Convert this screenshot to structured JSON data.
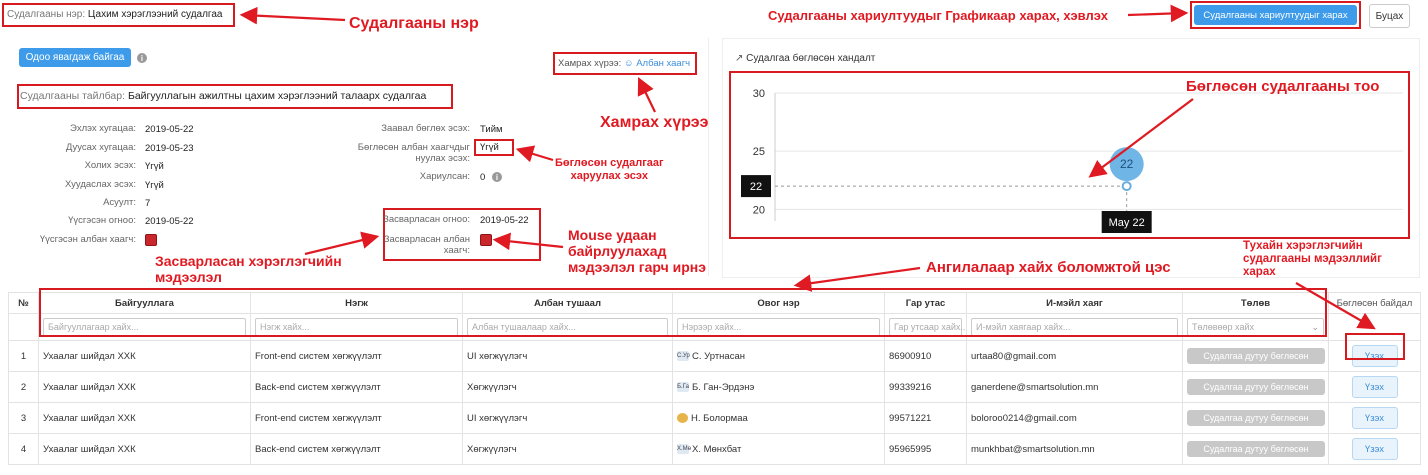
{
  "header": {
    "survey_name_label": "Судалгааны нэр:",
    "survey_name_value": "Цахим хэрэглээний судалгаа",
    "view_results_button": "Судалгааны хариултуудыг харах",
    "back_button": "Буцах"
  },
  "annotations": {
    "survey_name": "Судалгааны нэр",
    "graph_print": "Судалгааны хариултуудыг Графикаар харах, хэвлэх",
    "coverage": "Хамрах хүрээ",
    "submitted_count": "Бөглөсөн судалгааны тоо",
    "show_to_filled_line1": "Бөглөсөн судалгааг",
    "show_to_filled_line2": "харуулах эсэх",
    "mouse_line1": "Mouse удаан",
    "mouse_line2": "байрлуулахад",
    "mouse_line3": "мэдээлэл гарч ирнэ",
    "edited_user_line1": "Засварласан хэрэглэгчийн",
    "edited_user_line2": "мэдээлэл",
    "filter_row": "Ангилалаар хайх боломжтой цэс",
    "user_info_line1": "Тухайн хэрэглэгчийн",
    "user_info_line2": "судалгааны мэдээллийг",
    "user_info_line3": "харах"
  },
  "info_panel": {
    "status_badge": "Одоо явагдаж байгаа",
    "coverage_label": "Хамрах хүрээ:",
    "coverage_value": "Албан хаагч",
    "description_label": "Судалгааны тайлбар:",
    "description_value": "Байгууллагын ажилтны цахим хэрэглээний талаарх судалгаа",
    "left_fields": [
      {
        "label": "Эхлэх хугацаа:",
        "value": "2019-05-22"
      },
      {
        "label": "Дуусах хугацаа:",
        "value": "2019-05-23"
      },
      {
        "label": "Холих эсэх:",
        "value": "Үгүй"
      },
      {
        "label": "Хуудаслах эсэх:",
        "value": "Үгүй"
      },
      {
        "label": "Асуулт:",
        "value": "7"
      },
      {
        "label": "Үүсгэсэн огноо:",
        "value": "2019-05-22"
      },
      {
        "label": "Үүсгэсэн албан хаагч:",
        "value": ""
      }
    ],
    "required_label": "Заавал бөглөх эсэх:",
    "required_value": "Тийм",
    "show_filled_label_1": "Бөглөсөн албан хаагчдыг",
    "show_filled_label_2": "нуулах эсэх:",
    "show_filled_value": "Үгүй",
    "answered_label": "Хариулсан:",
    "answered_value": "0",
    "edited_date_label": "Засварласан огноо:",
    "edited_date_value": "2019-05-22",
    "edited_by_label_1": "Засварласан албан",
    "edited_by_label_2": "хаагч:"
  },
  "chart_panel": {
    "title": "Судалгаа бөглөсөн хандалт",
    "tooltip_y": "22",
    "tooltip_x": "May 22"
  },
  "chart_data": {
    "type": "line",
    "title": "Судалгаа бөглөсөн хандалт",
    "x": [
      "May 22"
    ],
    "series": [
      {
        "values": [
          22
        ]
      }
    ],
    "ylim": [
      19,
      30
    ],
    "yticks": [
      30,
      25,
      20
    ],
    "grid": true,
    "data_labels": [
      "22"
    ]
  },
  "table": {
    "headers": [
      "№",
      "Байгууллага",
      "Нэгж",
      "Албан тушаал",
      "Овог нэр",
      "Гар утас",
      "И-мэйл хаяг",
      "Төлөв",
      "Бөглөсөн байдал"
    ],
    "filter_placeholders": [
      "Байгууллагаар хайх...",
      "Нэгж хайх...",
      "Албан тушаалаар хайх...",
      "Нэрээр хайх...",
      "Гар утсаар хайх...",
      "И-мэйл хаягаар хайх...",
      "Төлөвөөр хайх"
    ],
    "rows": [
      {
        "no": "1",
        "org": "Ухаалаг шийдэл ХХК",
        "unit": "Front-end систем хөгжүүлэлт",
        "position": "UI хөгжүүлэгч",
        "avatar": "С.Ур",
        "name": "С. Уртнасан",
        "phone": "86900910",
        "email": "urtaa80@gmail.com",
        "status": "Судалгаа дутуу бөглөсөн",
        "action": "Үзэх"
      },
      {
        "no": "2",
        "org": "Ухаалаг шийдэл ХХК",
        "unit": "Back-end систем хөгжүүлэлт",
        "position": "Хөгжүүлэгч",
        "avatar": "Б.Га",
        "name": "Б. Ган-Эрдэнэ",
        "phone": "99339216",
        "email": "ganerdene@smartsolution.mn",
        "status": "Судалгаа дутуу бөглөсөн",
        "action": "Үзэх"
      },
      {
        "no": "3",
        "org": "Ухаалаг шийдэл ХХК",
        "unit": "Front-end систем хөгжүүлэлт",
        "position": "UI хөгжүүлэгч",
        "avatar": "",
        "name": "Н. Болормаа",
        "phone": "99571221",
        "email": "boloroo0214@gmail.com",
        "status": "Судалгаа дутуу бөглөсөн",
        "action": "Үзэх"
      },
      {
        "no": "4",
        "org": "Ухаалаг шийдэл ХХК",
        "unit": "Back-end систем хөгжүүлэлт",
        "position": "Хөгжүүлэгч",
        "avatar": "Х.Мө",
        "name": "Х. Мөнхбат",
        "phone": "95965995",
        "email": "munkhbat@smartsolution.mn",
        "status": "Судалгаа дутуу бөглөсөн",
        "action": "Үзэх"
      }
    ]
  },
  "colors": {
    "accent": "#3d9bea",
    "annotation_red": "#e01a22",
    "status_grey": "#c8c8c8"
  }
}
